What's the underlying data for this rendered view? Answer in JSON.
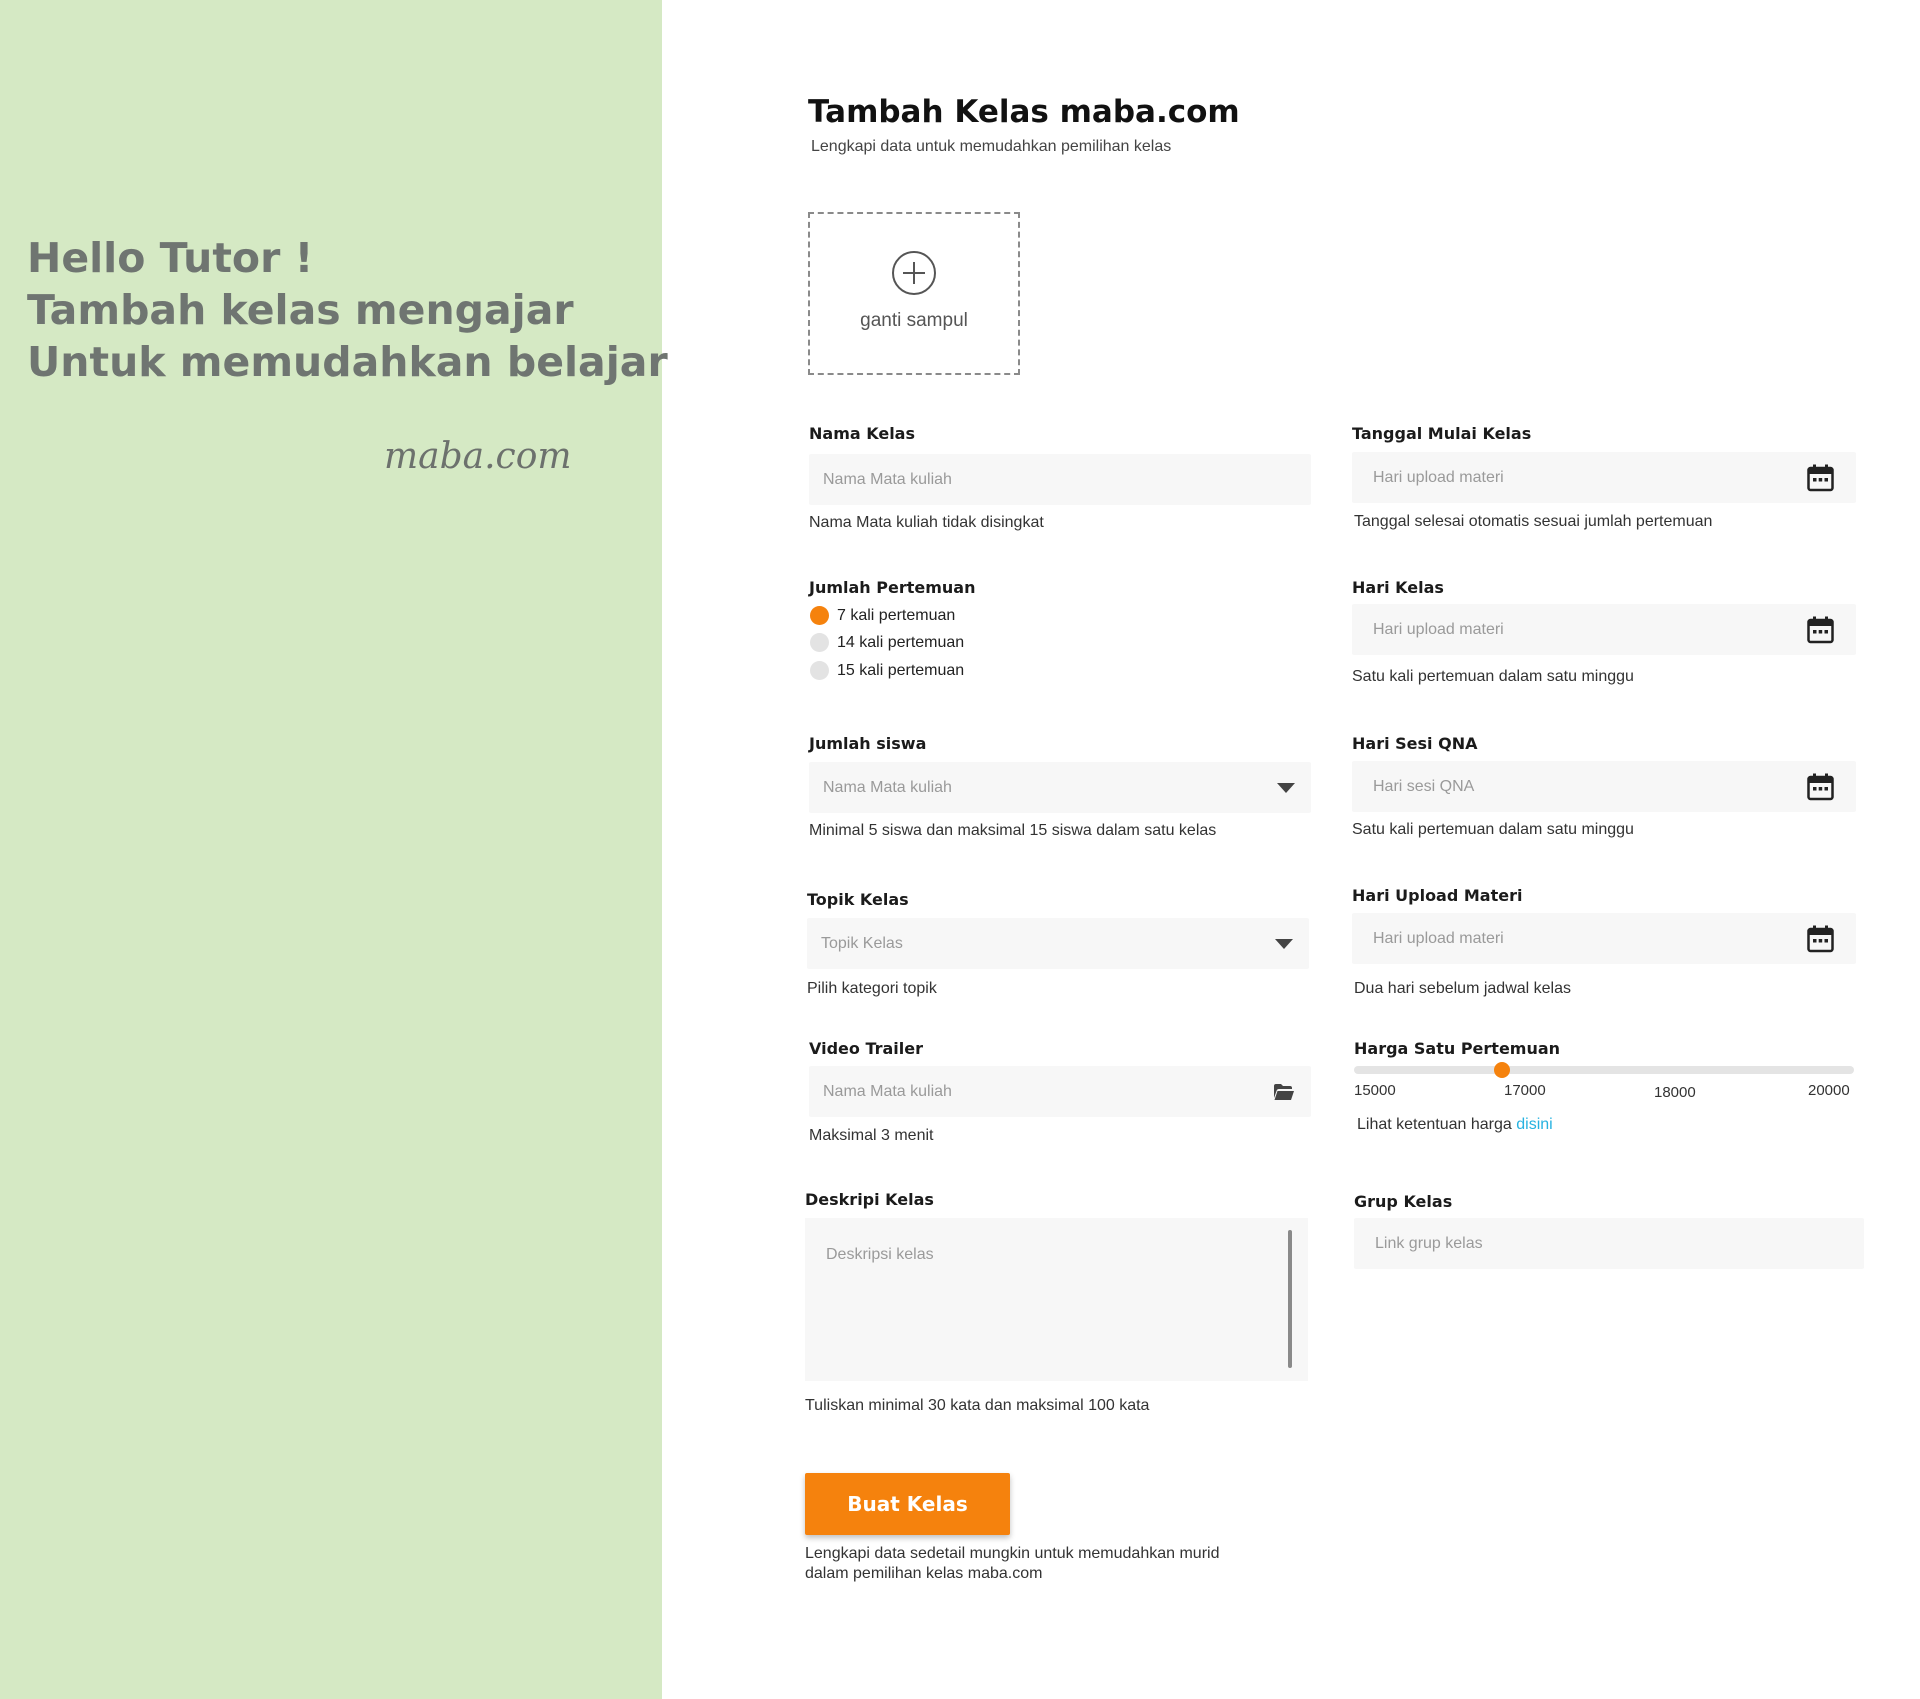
{
  "left_panel": {
    "greeting_lines": [
      "Hello Tutor !",
      "Tambah kelas mengajar",
      "Untuk memudahkan belajar"
    ],
    "brand": "maba.com",
    "background": "#d5e9c4"
  },
  "header": {
    "title": "Tambah Kelas maba.com",
    "subtitle": "Lengkapi data untuk memudahkan pemilihan kelas"
  },
  "cover": {
    "label": "ganti sampul",
    "icon": "plus-circle-icon"
  },
  "fields": {
    "nama_kelas": {
      "label": "Nama Kelas",
      "placeholder": "Nama Mata kuliah",
      "helper": "Nama Mata kuliah tidak disingkat"
    },
    "tanggal_mulai": {
      "label": "Tanggal Mulai Kelas",
      "placeholder": "Hari upload materi",
      "helper": "Tanggal selesai otomatis sesuai jumlah pertemuan",
      "icon": "calendar-icon"
    },
    "jumlah_pertemuan": {
      "label": "Jumlah Pertemuan",
      "options": [
        "7 kali pertemuan",
        "14 kali pertemuan",
        "15 kali pertemuan"
      ],
      "selected": "7 kali pertemuan"
    },
    "hari_kelas": {
      "label": "Hari Kelas",
      "placeholder": "Hari upload materi",
      "helper": "Satu kali pertemuan dalam satu minggu",
      "icon": "calendar-icon"
    },
    "jumlah_siswa": {
      "label": "Jumlah siswa",
      "placeholder": "Nama Mata kuliah",
      "helper": "Minimal 5 siswa dan maksimal 15 siswa dalam satu kelas",
      "icon": "caret-down-icon"
    },
    "hari_sesi_qna": {
      "label": "Hari Sesi QNA",
      "placeholder": "Hari sesi QNA",
      "helper": "Satu kali pertemuan dalam satu minggu",
      "icon": "calendar-icon"
    },
    "topik_kelas": {
      "label": "Topik Kelas",
      "placeholder": "Topik Kelas",
      "helper": "Pilih kategori topik",
      "icon": "caret-down-icon"
    },
    "hari_upload_materi": {
      "label": "Hari Upload Materi",
      "placeholder": "Hari upload materi",
      "helper": "Dua hari sebelum jadwal kelas",
      "icon": "calendar-icon"
    },
    "video_trailer": {
      "label": "Video Trailer",
      "placeholder": "Nama Mata kuliah",
      "helper": "Maksimal 3 menit",
      "icon": "folder-open-icon"
    },
    "harga": {
      "label": "Harga Satu Pertemuan",
      "ticks": [
        "15000",
        "17000",
        "18000",
        "20000"
      ],
      "min": 15000,
      "max": 20000,
      "value": 17000,
      "helper_prefix": "Lihat ketentuan harga",
      "helper_link": "disini"
    },
    "deskripsi": {
      "label": "Deskripi Kelas",
      "placeholder": "Deskripsi kelas",
      "helper": "Tuliskan minimal 30 kata dan maksimal 100 kata"
    },
    "grup_kelas": {
      "label": "Grup Kelas",
      "placeholder": "Link grup kelas"
    }
  },
  "submit": {
    "label": "Buat Kelas",
    "footnote": "Lengkapi data sedetail mungkin untuk memudahkan murid dalam pemilihan kelas maba.com"
  },
  "colors": {
    "accent": "#f5820d",
    "link": "#27b2e0",
    "input_bg": "#f7f7f7"
  }
}
